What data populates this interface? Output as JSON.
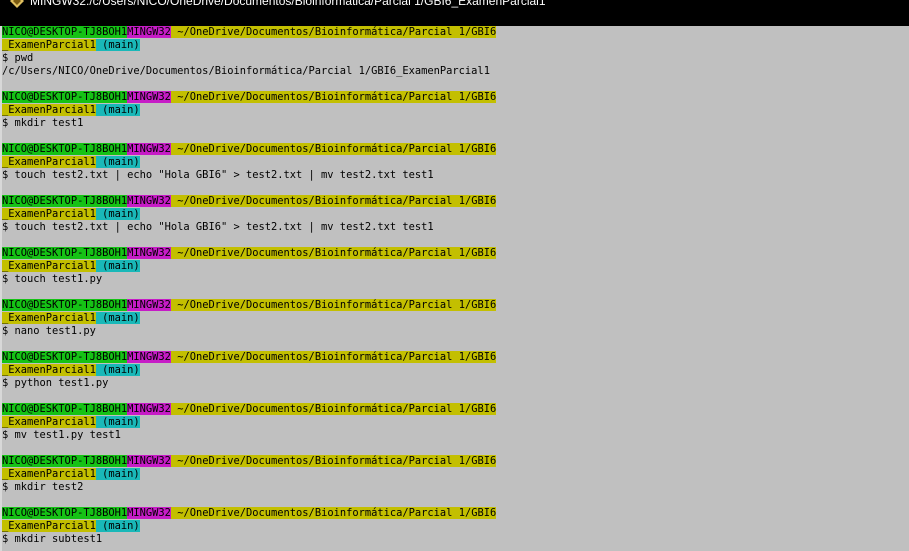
{
  "window": {
    "title": "MINGW32:/c/Users/NICO/OneDrive/Documentos/Bioinformática/Parcial 1/GBI6_ExamenParcial1",
    "icon": "git-bash-icon"
  },
  "prompt": {
    "user": "NICO@DESKTOP-TJ8BOH1",
    "env": "MINGW32",
    "path_line1": "~/OneDrive/Documentos/Bioinformática/Parcial 1/GBI6",
    "path_line2": "_ExamenParcial1",
    "branch": "(main)"
  },
  "blocks": [
    {
      "command": "$ pwd",
      "output": "/c/Users/NICO/OneDrive/Documentos/Bioinformática/Parcial 1/GBI6_ExamenParcial1"
    },
    {
      "command": "$ mkdir test1"
    },
    {
      "command": "$ touch test2.txt | echo \"Hola GBI6\" > test2.txt | mv test2.txt test1"
    },
    {
      "command": "$ touch test2.txt | echo \"Hola GBI6\" > test2.txt | mv test2.txt test1"
    },
    {
      "command": "$ touch test1.py"
    },
    {
      "command": "$ nano test1.py"
    },
    {
      "command": "$ python test1.py"
    },
    {
      "command": "$ mv test1.py test1"
    },
    {
      "command": "$ mkdir test2"
    },
    {
      "command": "$ mkdir subtest1"
    }
  ],
  "colors": {
    "user_bg": "#15c215",
    "env_bg": "#c61cc6",
    "path_bg": "#c3bf00",
    "branch_bg": "#19b8b8",
    "terminal_bg": "#c0c0c0"
  }
}
